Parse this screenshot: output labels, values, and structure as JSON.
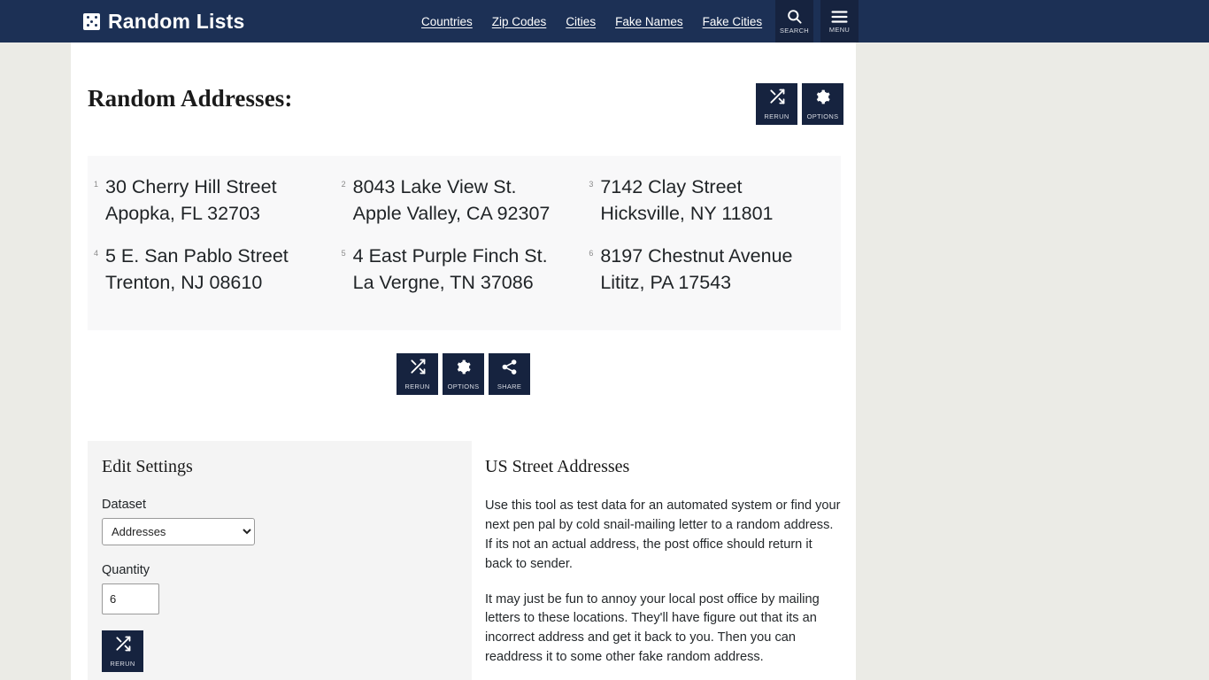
{
  "header": {
    "brand": "Random Lists",
    "logo_icon": "dice-icon",
    "nav": [
      {
        "label": "Countries"
      },
      {
        "label": "Zip Codes"
      },
      {
        "label": "Cities"
      },
      {
        "label": "Fake Names"
      },
      {
        "label": "Fake Cities"
      }
    ],
    "search_label": "SEARCH",
    "search_icon": "search-icon",
    "menu_label": "MENU",
    "menu_icon": "hamburger-icon",
    "background_color": "#1c3055"
  },
  "main": {
    "page_title": "Random Addresses:",
    "top_actions": [
      {
        "label": "RERUN",
        "icon": "shuffle-icon"
      },
      {
        "label": "OPTIONS",
        "icon": "gear-icon"
      }
    ],
    "results": [
      {
        "num": "1",
        "line1": "30 Cherry Hill Street",
        "line2": "Apopka, FL 32703"
      },
      {
        "num": "2",
        "line1": "8043 Lake View St.",
        "line2": "Apple Valley, CA 92307"
      },
      {
        "num": "3",
        "line1": "7142 Clay Street",
        "line2": "Hicksville, NY 11801"
      },
      {
        "num": "4",
        "line1": "5 E. San Pablo Street",
        "line2": "Trenton, NJ 08610"
      },
      {
        "num": "5",
        "line1": "4 East Purple Finch St.",
        "line2": "La Vergne, TN 37086"
      },
      {
        "num": "6",
        "line1": "8197 Chestnut Avenue",
        "line2": "Lititz, PA 17543"
      }
    ],
    "mid_actions": [
      {
        "label": "RERUN",
        "icon": "shuffle-icon"
      },
      {
        "label": "OPTIONS",
        "icon": "gear-icon"
      },
      {
        "label": "SHARE",
        "icon": "share-icon"
      }
    ]
  },
  "settings": {
    "heading": "Edit Settings",
    "dataset_label": "Dataset",
    "dataset_value": "Addresses",
    "dataset_options": [
      "Addresses"
    ],
    "quantity_label": "Quantity",
    "quantity_value": "6",
    "rerun_label": "RERUN",
    "rerun_icon": "shuffle-icon"
  },
  "article": {
    "heading": "US Street Addresses",
    "paragraph1": "Use this tool as test data for an automated system or find your next pen pal by cold snail-mailing letter to a random address. If its not an actual address, the post office should return it back to sender.",
    "paragraph2": "It may just be fun to annoy your local post office by mailing letters to these locations. They'll have figure out that its an incorrect address and get it back to you. Then you can readdress it to some other fake random address."
  },
  "colors": {
    "header_navy": "#1c3055",
    "button_navy": "#16233f",
    "page_bg": "#ebebe6",
    "results_bg": "#f8f8f9",
    "settings_bg": "#f4f4f4"
  }
}
